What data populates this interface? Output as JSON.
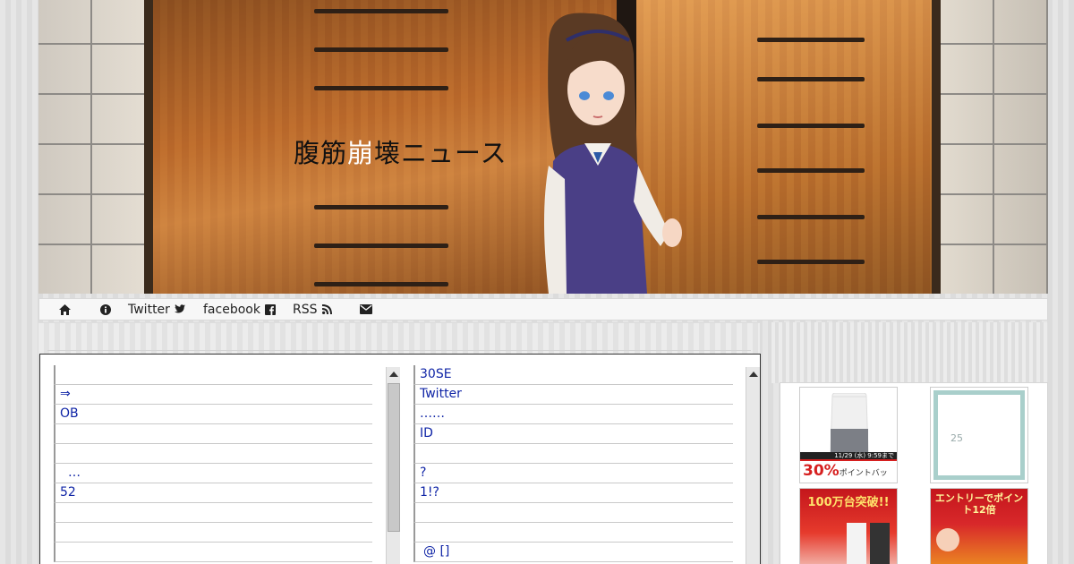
{
  "site": {
    "title_part1": "腹筋",
    "title_accent": "崩",
    "title_part2": "壊ニュース"
  },
  "nav": {
    "items": [
      {
        "label": "",
        "icon": "home-icon"
      },
      {
        "label": "",
        "icon": "info-icon"
      },
      {
        "label": "Twitter",
        "icon": "twitter-icon"
      },
      {
        "label": "facebook",
        "icon": "facebook-icon"
      },
      {
        "label": "RSS",
        "icon": "rss-icon"
      },
      {
        "label": "",
        "icon": "envelope-icon"
      }
    ]
  },
  "antenna": {
    "left": [
      "",
      "⇒",
      "OB",
      "",
      "",
      "…",
      "52",
      "",
      "",
      ""
    ],
    "right": [
      "30SE",
      "Twitter",
      "……",
      "ID",
      "",
      "?",
      "1!?",
      "",
      "",
      "@ []"
    ]
  },
  "ads": {
    "ad1_caption": "30%",
    "ad1_caption_small": "ポイントバック!",
    "ad1_top": "11/29 (水) 9:59まで",
    "ad2_caption": "25",
    "ad3_banner": "100万台突破!!",
    "ad4_banner": "エントリーでポイント12倍"
  },
  "colors": {
    "link": "#0f24a6",
    "accent_red": "#d61f1f"
  }
}
